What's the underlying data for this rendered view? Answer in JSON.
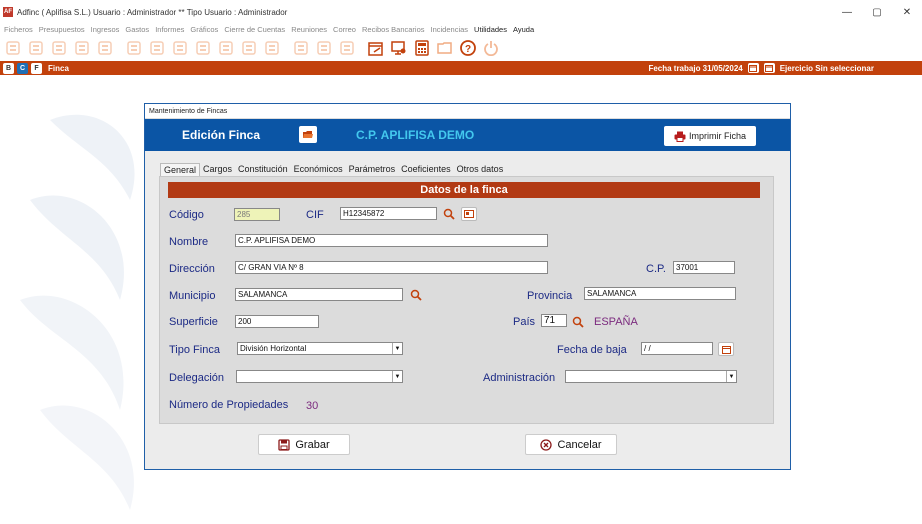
{
  "window": {
    "title": "Adfinc  ( Aplifisa S.L.)   Usuario : Administrador  **  Tipo Usuario : Administrador",
    "logo_text": "AF",
    "minimize": "—",
    "maximize": "▢",
    "close": "✕"
  },
  "menu": [
    "Ficheros",
    "Presupuestos",
    "Ingresos",
    "Gastos",
    "Informes",
    "Gráficos",
    "Cierre de Cuentas",
    "Reuniones",
    "Correo",
    "Recibos Bancarios",
    "Incidencias",
    "Utilidades",
    "Ayuda"
  ],
  "menu_active": [
    "Utilidades",
    "Ayuda"
  ],
  "toolbar_icons": [
    "document-icon",
    "home-icon",
    "building-icon",
    "users-icon",
    "search-document-icon",
    "hands-icon",
    "printer-icon",
    "laptop-icon",
    "money-chart-icon",
    "euro-coins-icon",
    "euro-bag-icon",
    "notes-icon",
    "signature-icon",
    "person-screen-icon",
    "hierarchy-icon",
    "calendar-edit-icon",
    "monitor-settings-icon",
    "calculator-icon",
    "folder-export-icon",
    "help-icon",
    "power-icon"
  ],
  "bar": {
    "b": "B",
    "c": "C",
    "f": "F",
    "title": "Finca",
    "fecha_trabajo": "Fecha trabajo  31/05/2024",
    "ejercicio": "Ejercicio   Sin seleccionar"
  },
  "dialog": {
    "window_title": "Mantenimiento de Fincas",
    "header_label": "Edición Finca",
    "header_name": "C.P. APLIFISA DEMO",
    "print_label": "Imprimir Ficha",
    "tabs": [
      "General",
      "Cargos",
      "Constitución",
      "Económicos",
      "Parámetros",
      "Coeficientes",
      "Otros datos"
    ],
    "section_title": "Datos de la finca",
    "labels": {
      "codigo": "Código",
      "cif": "CIF",
      "nombre": "Nombre",
      "direccion": "Dirección",
      "cp": "C.P.",
      "municipio": "Municipio",
      "provincia": "Provincia",
      "superficie": "Superficie",
      "pais": "País",
      "tipo_finca": "Tipo Finca",
      "fecha_baja": "Fecha de baja",
      "delegacion": "Delegación",
      "administracion": "Administración",
      "num_propiedades": "Número de Propiedades"
    },
    "values": {
      "codigo": "285",
      "cif": "H12345872",
      "nombre": "C.P. APLIFISA DEMO",
      "direccion": "C/ GRAN VIA Nº 8",
      "cp": "37001",
      "municipio": "SALAMANCA",
      "provincia": "SALAMANCA",
      "superficie": "200",
      "pais_code": "71",
      "pais_name": "ESPAÑA",
      "tipo_finca": "División Horizontal",
      "fecha_baja": " / /",
      "delegacion": "",
      "administracion": "",
      "num_propiedades": "30"
    },
    "grabar": "Grabar",
    "cancelar": "Cancelar"
  },
  "colors": {
    "accent_orange": "#c2410c",
    "header_blue": "#0b55a5",
    "section_red": "#b23a14",
    "label_blue": "#1c2a85",
    "purple": "#7b2a7e"
  }
}
